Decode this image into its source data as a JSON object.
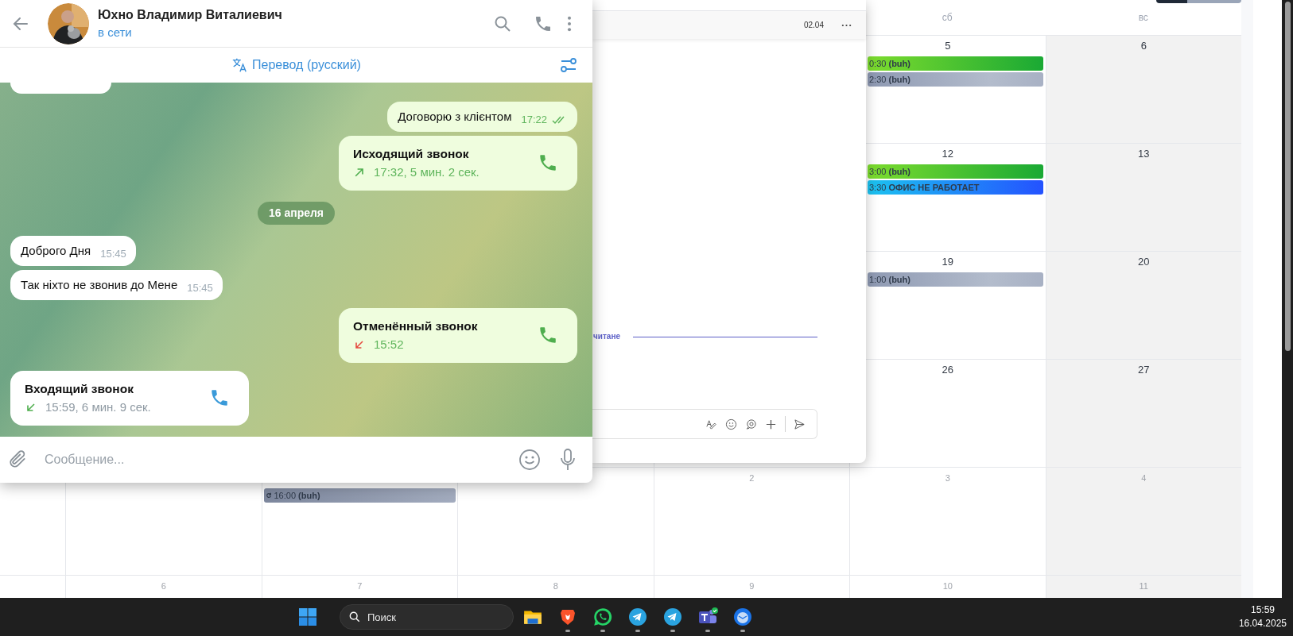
{
  "calendar": {
    "weekday_headers": [
      "сб",
      "вс"
    ],
    "weeks": [
      {
        "cells": [
          {
            "day": "5",
            "other_month": false,
            "events": [
              {
                "kind": "green",
                "recurring": false,
                "text": "0:30 **(buh)**"
              },
              {
                "kind": "gray",
                "recurring": false,
                "text": "2:30 **(buh)**"
              }
            ]
          },
          {
            "day": "6",
            "other_month": false
          }
        ]
      },
      {
        "cells": [
          {
            "day": "12",
            "other_month": false,
            "events": [
              {
                "kind": "green",
                "recurring": false,
                "text": "3:00 **(buh)**"
              },
              {
                "kind": "blue",
                "recurring": false,
                "text": "3:30 **ОФИС НЕ РАБОТАЕТ**"
              }
            ]
          },
          {
            "day": "13",
            "other_month": false
          }
        ]
      },
      {
        "cells": [
          {
            "day": "19",
            "other_month": false,
            "events": [
              {
                "kind": "gray",
                "recurring": false,
                "text": "1:00 **(buh)**"
              }
            ]
          },
          {
            "day": "20",
            "other_month": false
          }
        ]
      },
      {
        "cells": [
          {
            "day": "26",
            "other_month": false
          },
          {
            "day": "27",
            "other_month": false
          }
        ]
      },
      {
        "cells": [
          {
            "events": [
              {
                "kind": "slate",
                "recurring": true,
                "text": "16:00 **(buh)**"
              }
            ]
          },
          {},
          {
            "day": "2",
            "other_month": true
          },
          {
            "day": "3",
            "other_month": true
          },
          {
            "day": "4",
            "other_month": true
          }
        ]
      },
      {
        "cells": [
          {
            "day": "6",
            "other_month": true
          },
          {
            "day": "7",
            "other_month": true
          },
          {
            "day": "8",
            "other_month": true
          },
          {
            "day": "9",
            "other_month": true
          },
          {
            "day": "10",
            "other_month": true
          },
          {
            "day": "11",
            "other_month": true
          }
        ]
      }
    ]
  },
  "side_window": {
    "date": "02.04",
    "unread_label": "читане"
  },
  "chat": {
    "contact_name": "Юхно Владимир Виталиевич",
    "status": "в сети",
    "translation": "Перевод (русский)",
    "messages": [
      {
        "kind": "partial",
        "outgoing": false
      },
      {
        "kind": "text",
        "outgoing": true,
        "text": "Договорю з клієнтом",
        "time": "17:22",
        "read": true
      },
      {
        "kind": "call",
        "outgoing": true,
        "canceled": false,
        "title": "Исходящий звонок",
        "detail": "17:32, 5 мин. 2 сек."
      },
      {
        "kind": "date",
        "text": "16 апреля"
      },
      {
        "kind": "text",
        "outgoing": false,
        "text": "Доброго Дня",
        "time": "15:45"
      },
      {
        "kind": "text",
        "outgoing": false,
        "text": "Так ніхто не звонив до Мене",
        "time": "15:45"
      },
      {
        "kind": "call",
        "outgoing": true,
        "canceled": true,
        "title": "Отменённый звонок",
        "detail": "15:52"
      },
      {
        "kind": "call",
        "outgoing": false,
        "canceled": false,
        "title": "Входящий звонок",
        "detail": "15:59, 6 мин. 9 сек."
      }
    ],
    "input": {
      "placeholder": "Сообщение..."
    }
  },
  "taskbar": {
    "search": {
      "placeholder": "Поиск"
    },
    "apps": [
      {
        "kind": "folder",
        "running": false
      },
      {
        "kind": "browser",
        "running": true
      },
      {
        "kind": "whatsapp",
        "running": true
      },
      {
        "kind": "telegram",
        "running": true
      },
      {
        "kind": "telegram",
        "running": true
      },
      {
        "kind": "teams",
        "running": true
      },
      {
        "kind": "mail",
        "running": true
      }
    ],
    "clock": {
      "time": "15:59",
      "date": "16.04.2025"
    }
  }
}
